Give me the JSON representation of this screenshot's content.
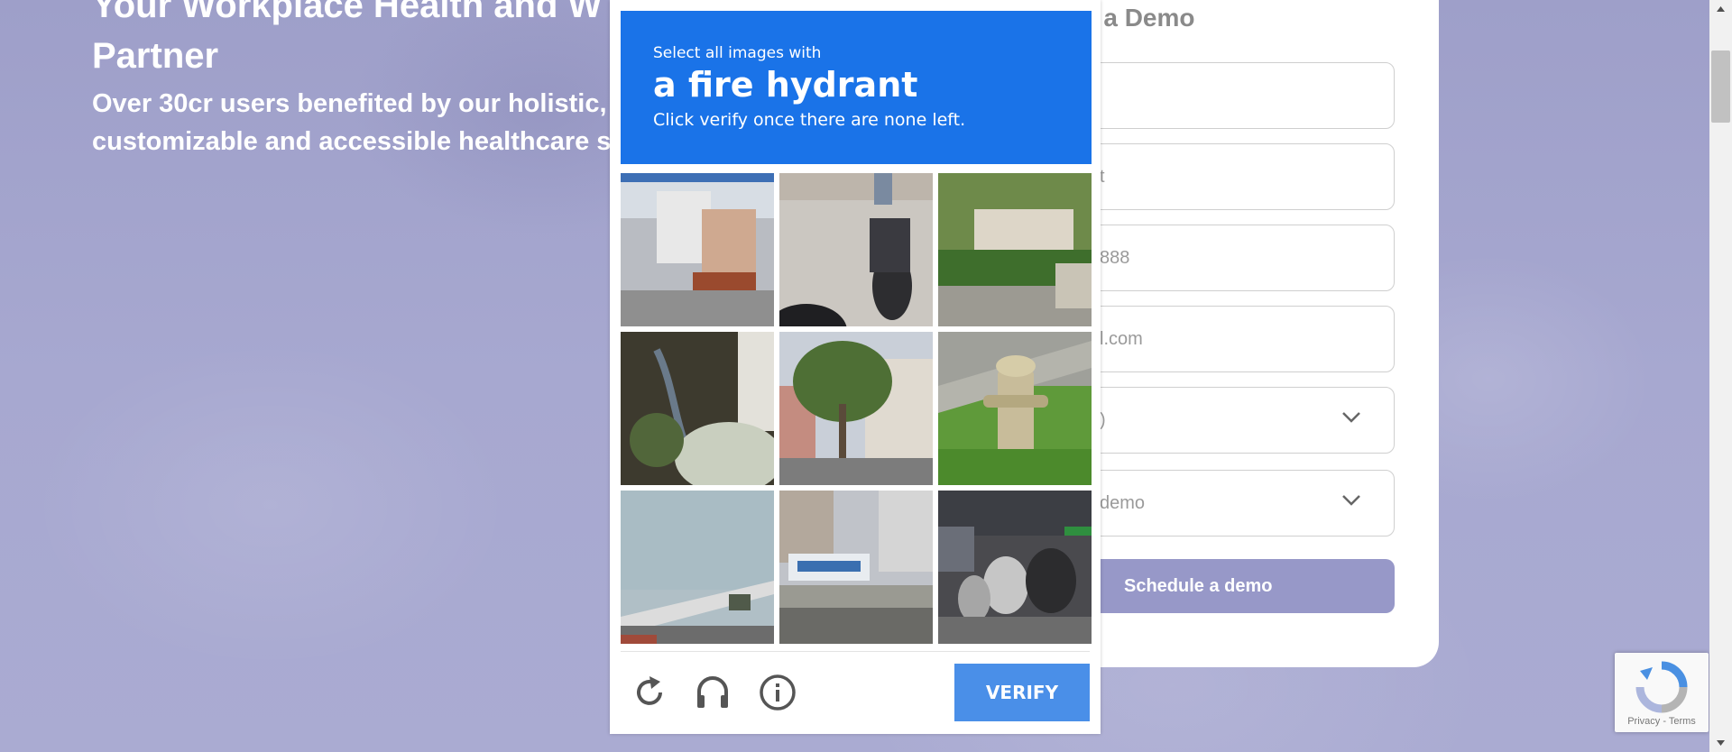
{
  "hero": {
    "title_line1": "Your Workplace Health and W",
    "title_line2": "Partner",
    "subtitle_line1": "Over 30cr users benefited by our holistic,",
    "subtitle_line2": "customizable and accessible healthcare solu"
  },
  "form": {
    "heading": "e a Demo",
    "fields": [
      {
        "value": ""
      },
      {
        "value": "t"
      },
      {
        "value": "888"
      },
      {
        "value": "l.com"
      },
      {
        "value": ")"
      },
      {
        "value": "demo"
      }
    ],
    "schedule_label": "Schedule a demo"
  },
  "captcha": {
    "instruction": "Select all images with",
    "target": "a fire hydrant",
    "hint": "Click verify once there are none left.",
    "verify_label": "VERIFY",
    "tiles": [
      "street-truck",
      "motorcycle",
      "hedge-house",
      "plants-railing",
      "tree-building",
      "fire-hydrant",
      "highway",
      "city-bus",
      "scooters"
    ],
    "accent_color": "#1a73e8"
  },
  "recaptcha_badge": {
    "links": "Privacy - Terms"
  }
}
